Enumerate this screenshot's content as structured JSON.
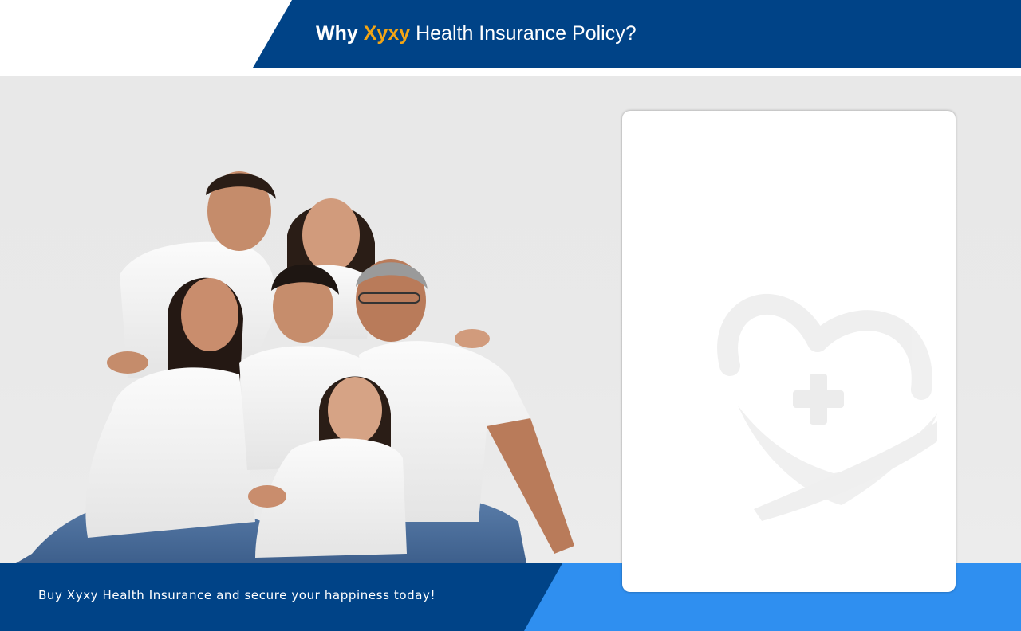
{
  "header": {
    "title_prefix": "Why",
    "title_brand": "Xyxy",
    "title_suffix": "Health Insurance Policy?"
  },
  "footer": {
    "tagline": "Buy Xyxy Health Insurance and secure your happiness today!"
  },
  "hero": {
    "image_subject": "family-photo"
  },
  "card": {
    "watermark_icon": "heart-hand-cross-icon"
  },
  "colors": {
    "primary_navy": "#004387",
    "accent_blue": "#2f8ff0",
    "brand_gold": "#f3a514",
    "background_grey": "#e8e8e8"
  }
}
